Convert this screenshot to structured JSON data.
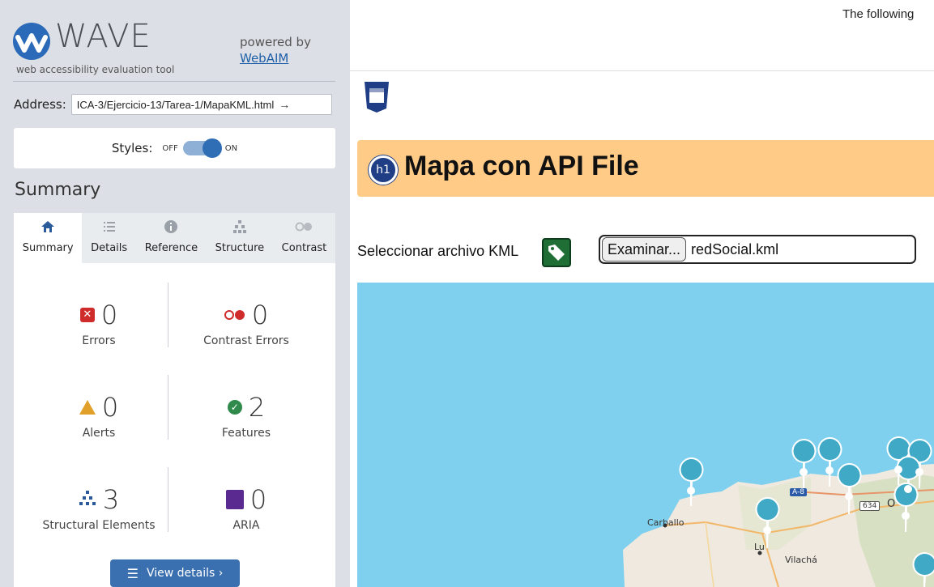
{
  "wave": {
    "logo_text": "WAVE",
    "logo_subtitle": "web accessibility evaluation tool",
    "powered_by": "powered by",
    "webaim_link": "WebAIM",
    "address_label": "Address:",
    "address_value": "ICA-3/Ejercicio-13/Tarea-1/MapaKML.html",
    "address_go_icon": "arrow-right-icon",
    "styles_label": "Styles:",
    "styles_off": "OFF",
    "styles_on": "ON",
    "summary_title": "Summary",
    "tabs": [
      {
        "label": "Summary",
        "icon": "home-icon",
        "active": true
      },
      {
        "label": "Details",
        "icon": "list-icon",
        "active": false
      },
      {
        "label": "Reference",
        "icon": "info-icon",
        "active": false
      },
      {
        "label": "Structure",
        "icon": "hierarchy-icon",
        "active": false
      },
      {
        "label": "Contrast",
        "icon": "contrast-icon",
        "active": false
      }
    ],
    "stats": {
      "errors": {
        "count": "0",
        "label": "Errors"
      },
      "contrast_errors": {
        "count": "0",
        "label": "Contrast Errors"
      },
      "alerts": {
        "count": "0",
        "label": "Alerts"
      },
      "features": {
        "count": "2",
        "label": "Features"
      },
      "structural": {
        "count": "3",
        "label": "Structural Elements"
      },
      "aria": {
        "count": "0",
        "label": "ARIA"
      }
    },
    "view_details": "View details ›"
  },
  "page": {
    "top_message": "The following",
    "heading_badge": "h1",
    "heading": "Mapa con API File",
    "file_label": "Seleccionar archivo KML",
    "file_button": "Examinar...",
    "file_name": "redSocial.kml",
    "map_labels": {
      "carballo": "Carballo",
      "lugo": "Lu",
      "vilacha": "Vilachá",
      "road_a8": "A-8",
      "road_634": "634",
      "oviedo_partial": "O"
    }
  },
  "colors": {
    "wave_blue": "#2a6ab8",
    "error_red": "#cf2b2b",
    "alert_orange": "#e0a02a",
    "feature_green": "#2f8a4b",
    "aria_purple": "#5a2a90",
    "heading_bg": "#ffcb87",
    "sea": "#7fd0ee",
    "marker": "#3fa9c6"
  }
}
